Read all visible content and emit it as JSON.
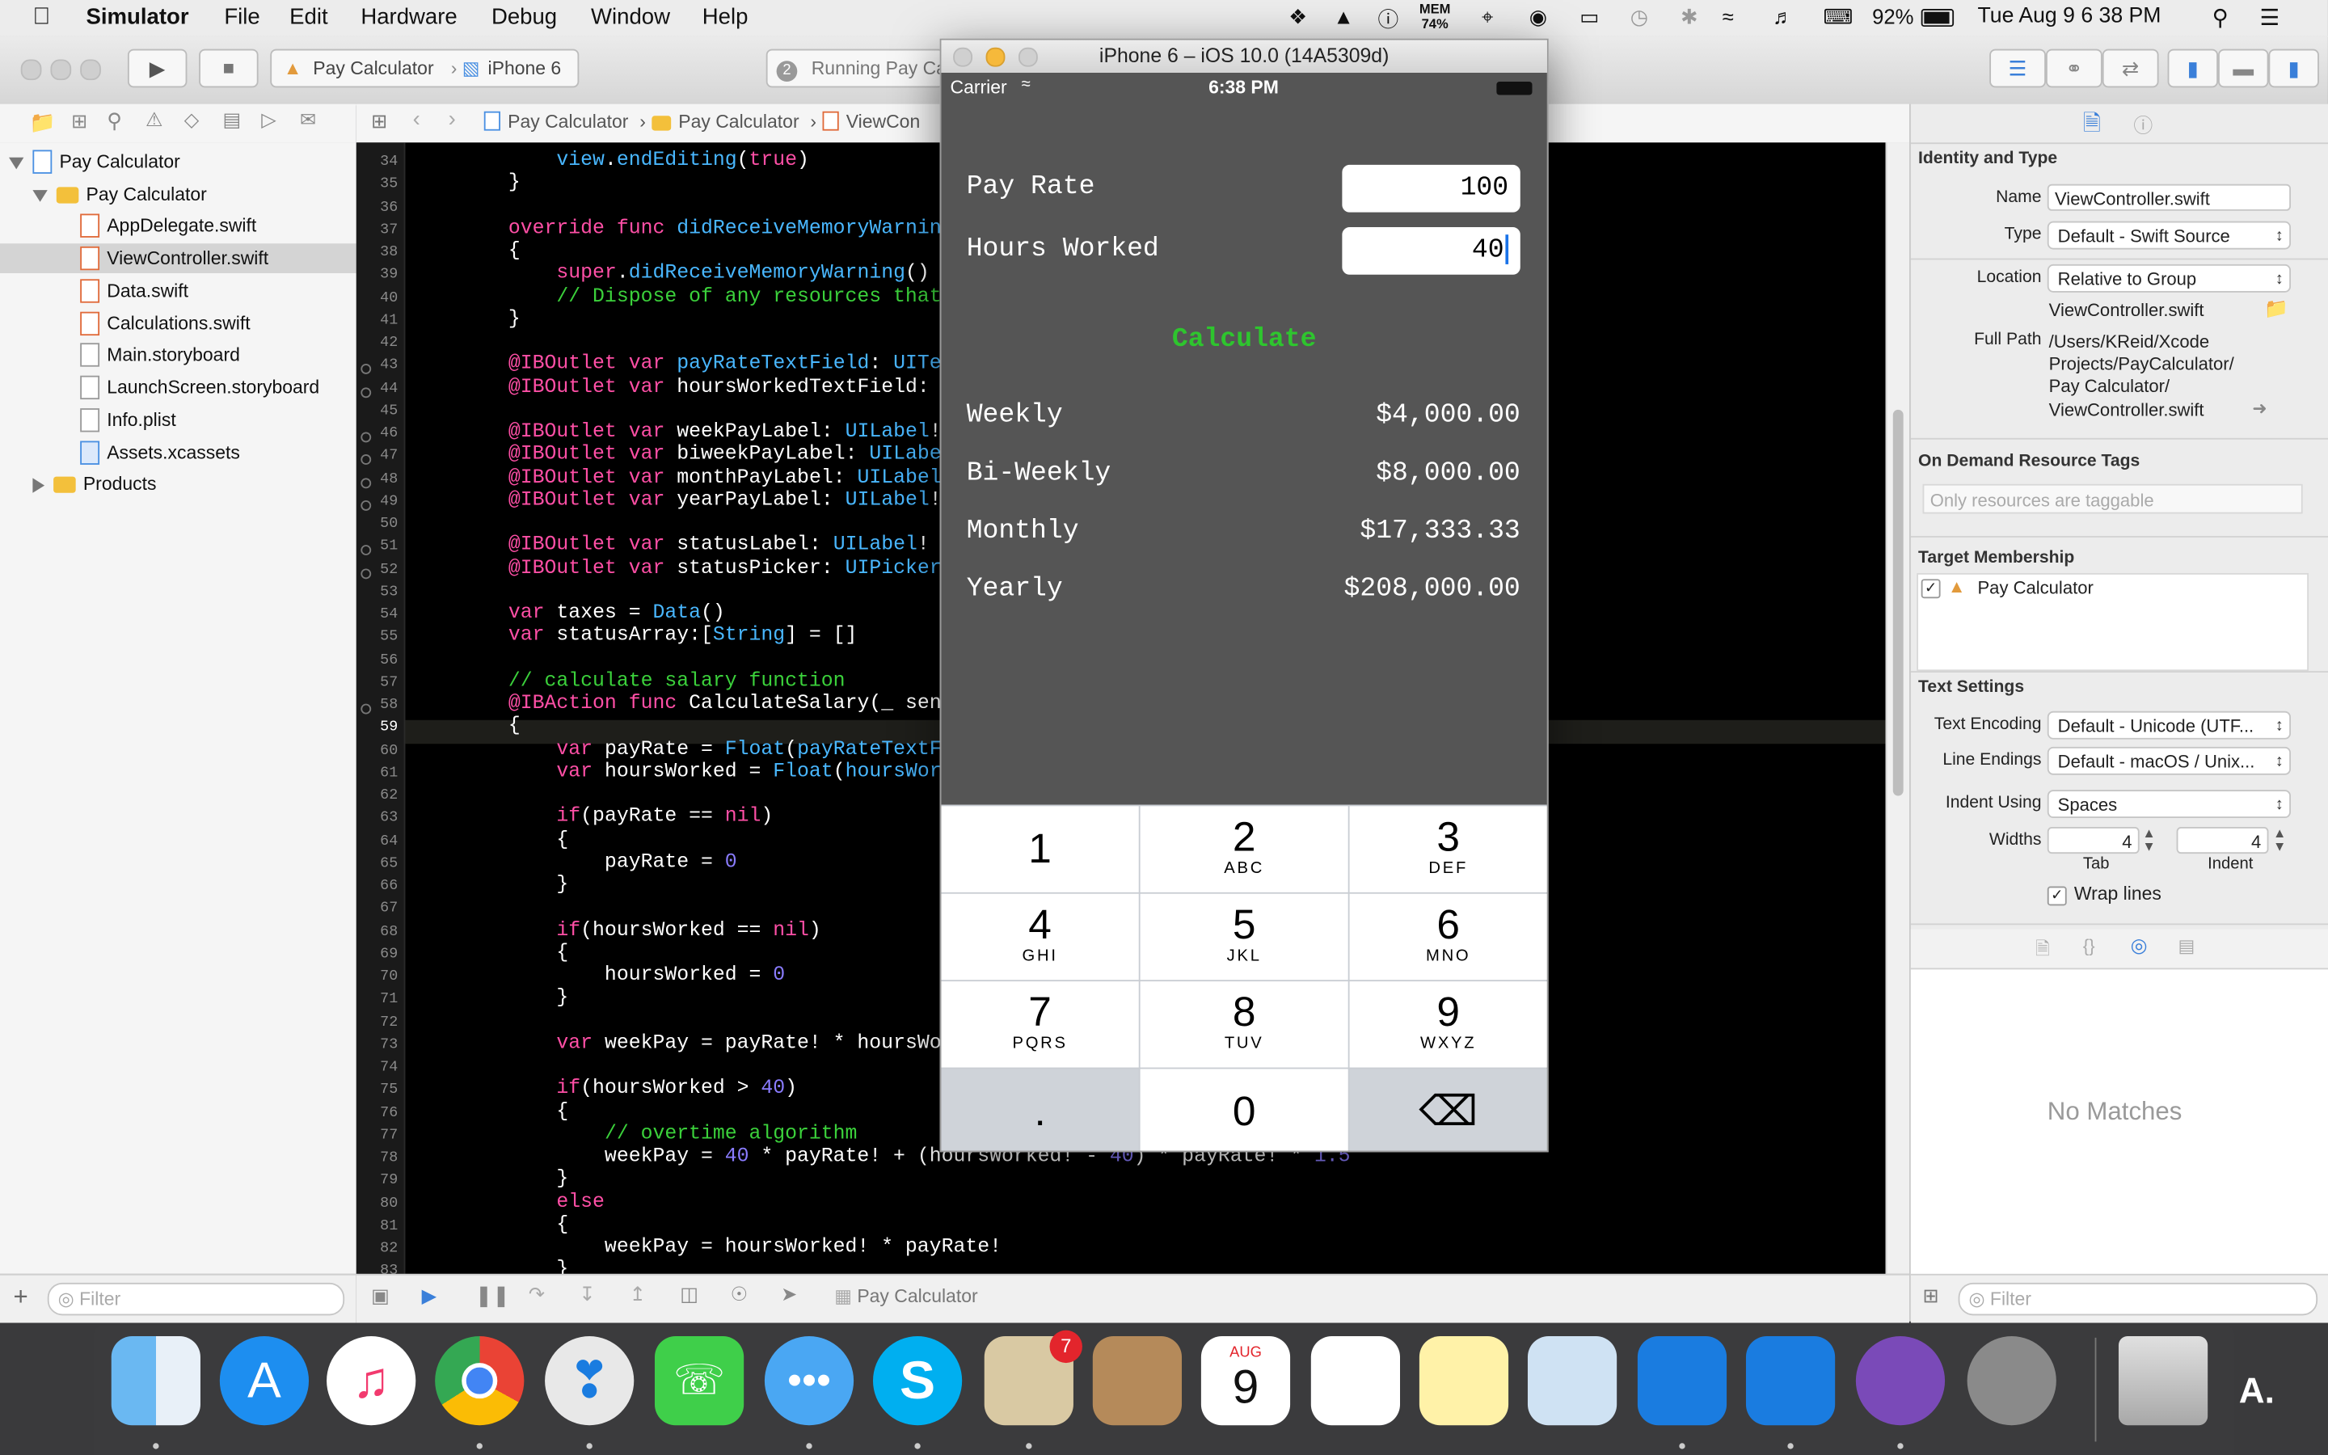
{
  "menubar": {
    "app": "Simulator",
    "items": [
      "File",
      "Edit",
      "Hardware",
      "Debug",
      "Window",
      "Help"
    ],
    "mem_label": "MEM",
    "mem_value": "74%",
    "battery": "92%",
    "clock": "Tue Aug 9  6 38 PM"
  },
  "toolbar": {
    "scheme": "Pay Calculator",
    "device": "iPhone 6",
    "activity_badge": "2",
    "activity": "Running Pay Ca"
  },
  "navigator": {
    "items": [
      {
        "label": "Pay Calculator",
        "kind": "project"
      },
      {
        "label": "Pay Calculator",
        "kind": "group"
      },
      {
        "label": "AppDelegate.swift",
        "kind": "swift"
      },
      {
        "label": "ViewController.swift",
        "kind": "swift",
        "selected": true
      },
      {
        "label": "Data.swift",
        "kind": "swift"
      },
      {
        "label": "Calculations.swift",
        "kind": "swift"
      },
      {
        "label": "Main.storyboard",
        "kind": "file"
      },
      {
        "label": "LaunchScreen.storyboard",
        "kind": "file"
      },
      {
        "label": "Info.plist",
        "kind": "file"
      },
      {
        "label": "Assets.xcassets",
        "kind": "file"
      },
      {
        "label": "Products",
        "kind": "group-collapsed"
      }
    ],
    "filter_placeholder": "Filter"
  },
  "jumpbar": {
    "crumbs": [
      "Pay Calculator",
      "Pay Calculator",
      "ViewCon"
    ]
  },
  "editor": {
    "current_line": "59",
    "lines": [
      {
        "n": "34",
        "code": "        view.endEditing(true)"
      },
      {
        "n": "35",
        "code": "    }"
      },
      {
        "n": "36",
        "code": ""
      },
      {
        "n": "37",
        "code": "    override func didReceiveMemoryWarning()"
      },
      {
        "n": "38",
        "code": "    {"
      },
      {
        "n": "39",
        "code": "        super.didReceiveMemoryWarning()"
      },
      {
        "n": "40",
        "code": "        // Dispose of any resources that can"
      },
      {
        "n": "41",
        "code": "    }"
      },
      {
        "n": "42",
        "code": ""
      },
      {
        "n": "43",
        "code": "    @IBOutlet var payRateTextField: UITextFi"
      },
      {
        "n": "44",
        "code": "    @IBOutlet var hoursWorkedTextField: UITe"
      },
      {
        "n": "45",
        "code": ""
      },
      {
        "n": "46",
        "code": "    @IBOutlet var weekPayLabel: UILabel!"
      },
      {
        "n": "47",
        "code": "    @IBOutlet var biweekPayLabel: UILabel!"
      },
      {
        "n": "48",
        "code": "    @IBOutlet var monthPayLabel: UILabel!"
      },
      {
        "n": "49",
        "code": "    @IBOutlet var yearPayLabel: UILabel!"
      },
      {
        "n": "50",
        "code": ""
      },
      {
        "n": "51",
        "code": "    @IBOutlet var statusLabel: UILabel!"
      },
      {
        "n": "52",
        "code": "    @IBOutlet var statusPicker: UIPickerView"
      },
      {
        "n": "53",
        "code": ""
      },
      {
        "n": "54",
        "code": "    var taxes = Data()"
      },
      {
        "n": "55",
        "code": "    var statusArray:[String] = []"
      },
      {
        "n": "56",
        "code": ""
      },
      {
        "n": "57",
        "code": "    // calculate salary function"
      },
      {
        "n": "58",
        "code": "    @IBAction func CalculateSalary(_ sender:"
      },
      {
        "n": "59",
        "code": "    {"
      },
      {
        "n": "60",
        "code": "        var payRate = Float(payRateTextField"
      },
      {
        "n": "61",
        "code": "        var hoursWorked = Float(hoursWorkedT"
      },
      {
        "n": "62",
        "code": ""
      },
      {
        "n": "63",
        "code": "        if(payRate == nil)"
      },
      {
        "n": "64",
        "code": "        {"
      },
      {
        "n": "65",
        "code": "            payRate = 0"
      },
      {
        "n": "66",
        "code": "        }"
      },
      {
        "n": "67",
        "code": ""
      },
      {
        "n": "68",
        "code": "        if(hoursWorked == nil)"
      },
      {
        "n": "69",
        "code": "        {"
      },
      {
        "n": "70",
        "code": "            hoursWorked = 0"
      },
      {
        "n": "71",
        "code": "        }"
      },
      {
        "n": "72",
        "code": ""
      },
      {
        "n": "73",
        "code": "        var weekPay = payRate! * hoursWorked"
      },
      {
        "n": "74",
        "code": ""
      },
      {
        "n": "75",
        "code": "        if(hoursWorked > 40)"
      },
      {
        "n": "76",
        "code": "        {"
      },
      {
        "n": "77",
        "code": "            // overtime algorithm"
      },
      {
        "n": "78",
        "code": "            weekPay = 40 * payRate! + (hoursWorked! - 40) * payRate! * 1.5"
      },
      {
        "n": "79",
        "code": "        }"
      },
      {
        "n": "80",
        "code": "        else"
      },
      {
        "n": "81",
        "code": "        {"
      },
      {
        "n": "82",
        "code": "            weekPay = hoursWorked! * payRate!"
      },
      {
        "n": "83",
        "code": "        }"
      }
    ]
  },
  "debugbar": {
    "target": "Pay Calculator"
  },
  "inspector": {
    "identity_title": "Identity and Type",
    "name_label": "Name",
    "name_value": "ViewController.swift",
    "type_label": "Type",
    "type_value": "Default - Swift Source",
    "location_label": "Location",
    "location_value": "Relative to Group",
    "location_file": "ViewController.swift",
    "fullpath_label": "Full Path",
    "fullpath_lines": [
      "/Users/KReid/Xcode",
      "Projects/PayCalculator/",
      "Pay Calculator/",
      "ViewController.swift"
    ],
    "odr_title": "On Demand Resource Tags",
    "odr_placeholder": "Only resources are taggable",
    "target_title": "Target Membership",
    "target_item": "Pay Calculator",
    "text_title": "Text Settings",
    "encoding_label": "Text Encoding",
    "encoding_value": "Default - Unicode (UTF...",
    "endings_label": "Line Endings",
    "endings_value": "Default - macOS / Unix...",
    "indent_label": "Indent Using",
    "indent_value": "Spaces",
    "widths_label": "Widths",
    "tab_value": "4",
    "indent_width_value": "4",
    "tab_caption": "Tab",
    "indent_caption": "Indent",
    "wrap_label": "Wrap lines",
    "no_matches": "No Matches",
    "filter_placeholder": "Filter"
  },
  "simulator": {
    "title": "iPhone 6 – iOS 10.0 (14A5309d)",
    "carrier": "Carrier",
    "time": "6:38 PM",
    "pay_rate_label": "Pay Rate",
    "pay_rate_value": "100",
    "hours_label": "Hours Worked",
    "hours_value": "40",
    "calculate": "Calculate",
    "results": [
      {
        "label": "Weekly",
        "value": "$4,000.00"
      },
      {
        "label": "Bi-Weekly",
        "value": "$8,000.00"
      },
      {
        "label": "Monthly",
        "value": "$17,333.33"
      },
      {
        "label": "Yearly",
        "value": "$208,000.00"
      }
    ],
    "keys": [
      {
        "d": "1",
        "l": ""
      },
      {
        "d": "2",
        "l": "ABC"
      },
      {
        "d": "3",
        "l": "DEF"
      },
      {
        "d": "4",
        "l": "GHI"
      },
      {
        "d": "5",
        "l": "JKL"
      },
      {
        "d": "6",
        "l": "MNO"
      },
      {
        "d": "7",
        "l": "PQRS"
      },
      {
        "d": "8",
        "l": "TUV"
      },
      {
        "d": "9",
        "l": "WXYZ"
      },
      {
        "d": ".",
        "l": ""
      },
      {
        "d": "0",
        "l": ""
      },
      {
        "d": "⌫",
        "l": ""
      }
    ]
  },
  "dock": {
    "calendar_month": "AUG",
    "calendar_day": "9",
    "mail_badge": "7",
    "apps": [
      "finder",
      "app-store",
      "itunes",
      "chrome",
      "safari",
      "facetime",
      "messages",
      "skype",
      "mail",
      "contacts",
      "calendar",
      "reminders",
      "notes",
      "preview",
      "xcode-beta",
      "simulator-beta",
      "github",
      "system-preferences",
      "trash"
    ]
  },
  "colors": {
    "calculate_green": "#2ec52e",
    "keyword_pink": "#ff4fa6",
    "type_blue": "#49b7ff",
    "comment_green": "#3bd13b",
    "number_purple": "#8a7cff"
  }
}
